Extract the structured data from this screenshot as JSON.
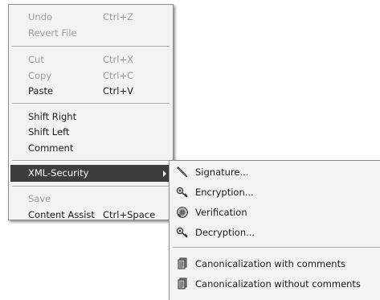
{
  "main_menu": {
    "undo": {
      "label": "Undo",
      "shortcut": "Ctrl+Z"
    },
    "revert_file": {
      "label": "Revert File"
    },
    "cut": {
      "label": "Cut",
      "shortcut": "Ctrl+X"
    },
    "copy": {
      "label": "Copy",
      "shortcut": "Ctrl+C"
    },
    "paste": {
      "label": "Paste",
      "shortcut": "Ctrl+V"
    },
    "shift_right": {
      "label": "Shift Right"
    },
    "shift_left": {
      "label": "Shift Left"
    },
    "comment": {
      "label": "Comment"
    },
    "xml_security": {
      "label": "XML-Security"
    },
    "save": {
      "label": "Save"
    },
    "content_assist": {
      "label": "Content Assist",
      "shortcut": "Ctrl+Space"
    }
  },
  "xml_security_submenu": {
    "signature": {
      "label": "Signature...",
      "icon": "pen-icon"
    },
    "encryption": {
      "label": "Encryption...",
      "icon": "key-lock-icon"
    },
    "verification": {
      "label": "Verification",
      "icon": "seal-check-icon"
    },
    "decryption": {
      "label": "Decryption...",
      "icon": "key-unlock-icon"
    },
    "canon_with": {
      "label": "Canonicalization with comments",
      "icon": "document-stack-icon"
    },
    "canon_without": {
      "label": "Canonicalization without comments",
      "icon": "document-stack-icon"
    }
  }
}
